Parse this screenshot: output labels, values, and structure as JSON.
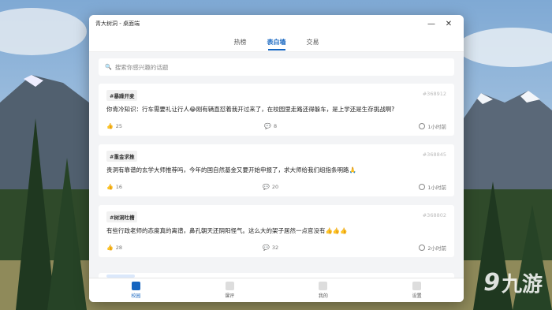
{
  "window": {
    "title": "青大树洞 - 桌面端",
    "close_glyph": "✕",
    "min_glyph": "—"
  },
  "tabs": [
    {
      "label": "热榜",
      "active": false
    },
    {
      "label": "表白墙",
      "active": true
    },
    {
      "label": "交易",
      "active": false
    }
  ],
  "search": {
    "placeholder": "搜索你感兴趣的话题",
    "icon": "search-icon"
  },
  "posts": [
    {
      "tag": "#暴躁开麦",
      "id": "#368912",
      "text": "你青冷知识：行车需要礼让行人😂刚有辆直怼着我开过来了，在校园里走路还得躲车，是上学还是生存挑战啊?",
      "likes": "25",
      "comments": "8",
      "time": "1小时前"
    },
    {
      "tag": "#重金求推",
      "id": "#368845",
      "text": "贵洞有靠谱的玄学大师推荐吗，今年的国自然基金又要开始申报了，求大师给我们组指条明路🙏",
      "likes": "16",
      "comments": "20",
      "time": "1小时前"
    },
    {
      "tag": "#树洞吐槽",
      "id": "#368802",
      "text": "有些行政老师的态度真的离谱，鼻孔朝天还阴阳怪气。这么大的架子居然一点官没有👍👍👍",
      "likes": "28",
      "comments": "32",
      "time": "2小时前"
    }
  ],
  "nav": [
    {
      "label": "校园",
      "active": true
    },
    {
      "label": "课评",
      "active": false
    },
    {
      "label": "我的",
      "active": false
    },
    {
      "label": "设置",
      "active": false
    }
  ],
  "watermark": {
    "num": "9",
    "text": "九游"
  },
  "colors": {
    "accent": "#1565c0",
    "like": "#e0a020"
  }
}
